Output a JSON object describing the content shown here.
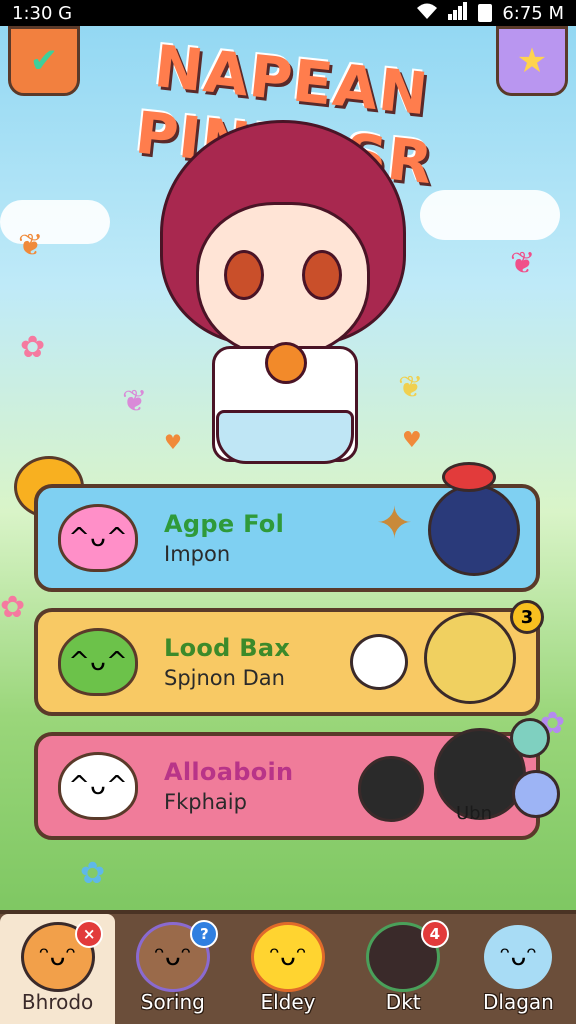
{
  "status_bar": {
    "time": "1:30",
    "carrier": "G",
    "clock": "6:75",
    "suffix": "M"
  },
  "title": "NAPEAN PINDRSR",
  "corner_buttons": {
    "left_icon": "checkmark-icon",
    "right_icon": "star-icon"
  },
  "cards": [
    {
      "title": "Agpe Fol",
      "subtitle": "Impon",
      "color": "#7fd0f2",
      "pet_color": "#ff8fc8"
    },
    {
      "title": "Lood Bax",
      "subtitle": "Spjnon Dan",
      "color": "#f8c964",
      "pet_color": "#6cc24a",
      "badge": "3"
    },
    {
      "title": "Alloaboin",
      "subtitle": "Fkphaip",
      "color": "#f07c9a",
      "pet_color": "#ffffff",
      "tag": "Ubn"
    }
  ],
  "bottom_nav": [
    {
      "label": "Bhrodo",
      "badge": "×",
      "badge_color": "#e23b3b",
      "active": true
    },
    {
      "label": "Soring",
      "badge": "?",
      "badge_color": "#2f7fe0"
    },
    {
      "label": "Eldey"
    },
    {
      "label": "Dkt",
      "badge": "4",
      "badge_color": "#e23b3b"
    },
    {
      "label": "Dlagan"
    }
  ],
  "colors": {
    "accent": "#f2803f",
    "nav_bg": "#6b4e3a",
    "border": "#5a3a2a"
  }
}
